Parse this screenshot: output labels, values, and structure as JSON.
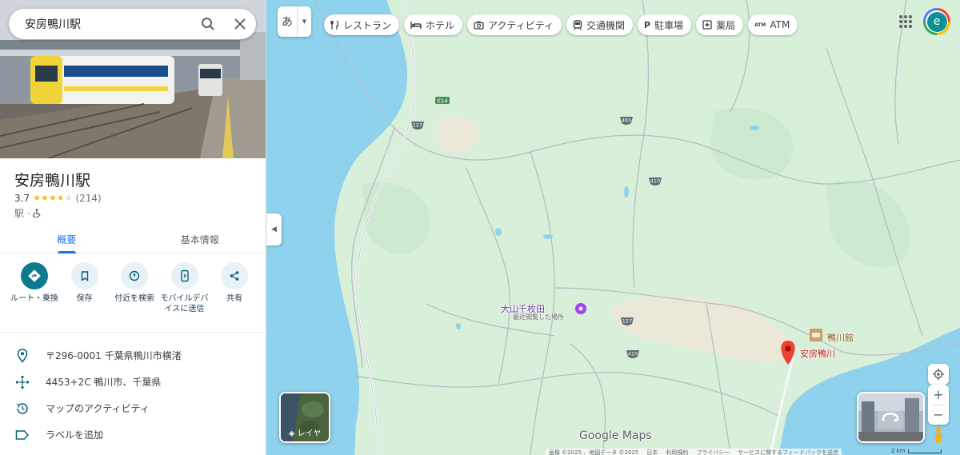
{
  "search": {
    "query": "安房鴨川駅"
  },
  "place": {
    "title": "安房鴨川駅",
    "rating": "3.7",
    "stars": 3.7,
    "review_count": "(214)",
    "category": "駅 ·",
    "accessibility_icon": "wheelchair-icon"
  },
  "tabs": [
    {
      "label": "概要",
      "active": true
    },
    {
      "label": "基本情報",
      "active": false
    }
  ],
  "actions": [
    {
      "label": "ルート・乗換",
      "icon": "directions-icon"
    },
    {
      "label": "保存",
      "icon": "bookmark-icon"
    },
    {
      "label": "付近を検索",
      "icon": "nearby-icon"
    },
    {
      "label": "モバイルデバイスに送信",
      "icon": "send-to-phone-icon"
    },
    {
      "label": "共有",
      "icon": "share-icon"
    }
  ],
  "info": [
    {
      "text": "〒296-0001 千葉県鴨川市横渚",
      "icon": "location-pin-icon"
    },
    {
      "text": "4453+2C 鴨川市、千葉県",
      "icon": "plus-code-icon"
    },
    {
      "text": "マップのアクティビティ",
      "icon": "history-icon"
    },
    {
      "text": "ラベルを追加",
      "icon": "label-icon"
    }
  ],
  "map": {
    "language_button": "あ",
    "chips": [
      {
        "label": "レストラン",
        "icon": "restaurant-icon"
      },
      {
        "label": "ホテル",
        "icon": "hotel-icon"
      },
      {
        "label": "アクティビティ",
        "icon": "camera-icon"
      },
      {
        "label": "交通機関",
        "icon": "transit-icon"
      },
      {
        "label": "駐車場",
        "icon": "parking-icon"
      },
      {
        "label": "薬局",
        "icon": "pharmacy-icon"
      },
      {
        "label": "ATM",
        "icon": "atm-icon"
      }
    ],
    "avatar_letter": "e",
    "labels": {
      "oyama_senmaida": "大山千枚田",
      "recently_viewed": "最近閲覧した場所",
      "kamogawa_kan": "鴨川館",
      "awa_kamogawa": "安房鴨川",
      "route_127_top": "127",
      "route_127_bottom": "127",
      "route_465": "465",
      "route_410_top": "410",
      "route_410_bottom": "410",
      "expressway": "E14"
    },
    "layers_label": "レイヤ",
    "brand": "Google Maps",
    "footer": [
      "画像 ©2025 、地図データ ©2025",
      "日本",
      "利用規約",
      "プライバシー",
      "サービスに関するフィードバックを送信"
    ],
    "scale": "2 km",
    "colors": {
      "water": "#8ed2ee",
      "land": "#d8efd9",
      "urban": "#f1e6d6",
      "pin": "#ea4335",
      "accent": "#1a73e8"
    }
  }
}
